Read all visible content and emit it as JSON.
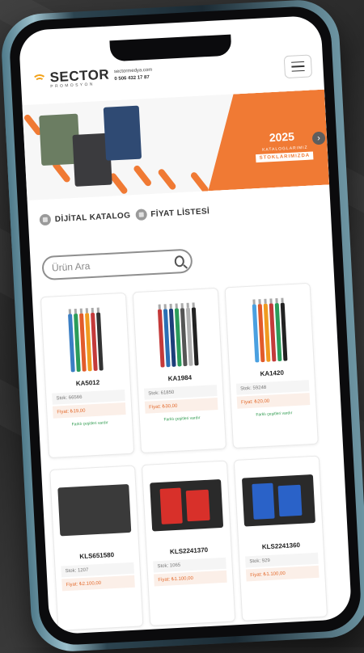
{
  "header": {
    "brand": "SECTOR",
    "brand_sub": "PROMOSYON",
    "web": "sectormedya.com",
    "phone": "0 506 432 17 87"
  },
  "banner": {
    "year": "2025",
    "tag1": "KATALOGLARIMIZ",
    "tag2": "STOKLARIMIZDA"
  },
  "links": {
    "catalog": "DİJİTAL KATALOG",
    "pricelist": "FİYAT LİSTESİ"
  },
  "search": {
    "placeholder": "Ürün Ara"
  },
  "products": [
    {
      "code": "KA5012",
      "stock": "Stok: 66566",
      "price": "Fiyat: ₺19,00",
      "variant": "Farklı çeşitleri vardır"
    },
    {
      "code": "KA1984",
      "stock": "Stok: 61850",
      "price": "Fiyat: ₺30,00",
      "variant": "Farklı çeşitleri vardır"
    },
    {
      "code": "KA1420",
      "stock": "Stok: 59248",
      "price": "Fiyat: ₺20,00",
      "variant": "Farklı çeşitleri vardır"
    },
    {
      "code": "KLS651580",
      "stock": "Stok: 1207",
      "price": "Fiyat: ₺2.100,00"
    },
    {
      "code": "KLS2241370",
      "stock": "Stok: 1065",
      "price": "Fiyat: ₺1.100,00"
    },
    {
      "code": "KLS2241360",
      "stock": "Stok: 929",
      "price": "Fiyat: ₺1.100,00"
    }
  ],
  "colors": {
    "accent": "#f07a34",
    "price": "#e36a2c",
    "variant": "#2e9a4e",
    "logo": "#f2a21a"
  }
}
